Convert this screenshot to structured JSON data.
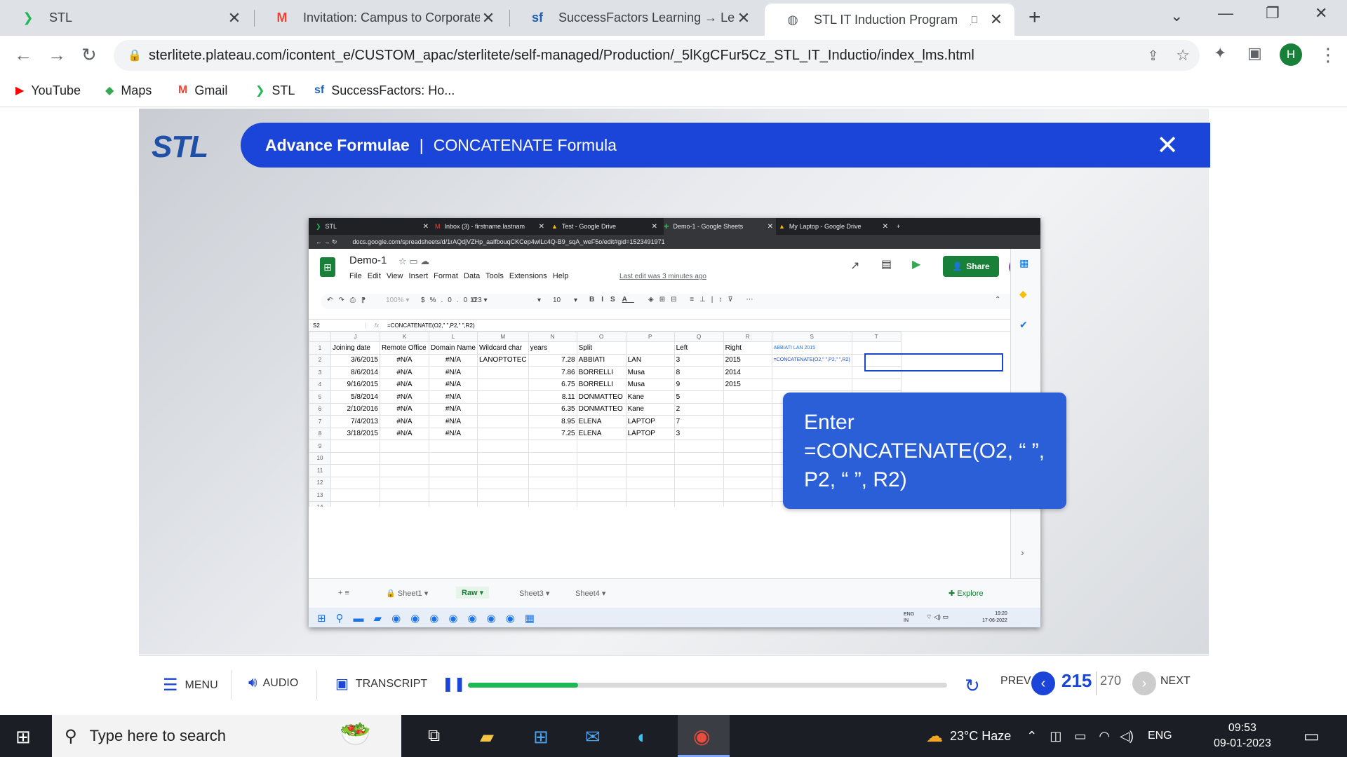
{
  "browser": {
    "tabs": [
      {
        "title": "STL",
        "icon": "stl-arrow-icon"
      },
      {
        "title": "Invitation: Campus to Corporate",
        "icon": "gmail-icon"
      },
      {
        "title": "SuccessFactors Learning → Learn",
        "icon": "successfactors-icon"
      },
      {
        "title": "STL IT Induction Program",
        "icon": "globe-icon"
      }
    ],
    "url": "sterlitete.plateau.com/icontent_e/CUSTOM_apac/sterlitete/self-managed/Production/_5lKgCFur5Cz_STL_IT_Inductio/index_lms.html",
    "bookmarks": [
      "YouTube",
      "Maps",
      "Gmail",
      "STL",
      "SuccessFactors: Ho..."
    ],
    "profile_initial": "H"
  },
  "course": {
    "logo": "STL",
    "title_bold": "Advance Formulae",
    "title_sep": "|",
    "title_rest": "CONCATENATE Formula",
    "callout": "Enter =CONCATENATE(O2, “ ”, P2, “ ”, R2)"
  },
  "embedded": {
    "tabs": [
      "STL",
      "Inbox (3) - firstname.lastnam",
      "Test - Google Drive",
      "Demo-1 - Google Sheets",
      "My Laptop - Google Drive"
    ],
    "url": "docs.google.com/spreadsheets/d/1rAQdjVZHp_aalfbouqCKCep4wlLc4Q-B9_sqA_weF5o/edit#gid=1523491971",
    "doc_title": "Demo-1",
    "menus": [
      "File",
      "Edit",
      "View",
      "Insert",
      "Format",
      "Data",
      "Tools",
      "Extensions",
      "Help"
    ],
    "last_edit": "Last edit was 3 minutes ago",
    "share": "Share",
    "avatar": "F",
    "cell_ref": "S2",
    "formula": "=CONCATENATE(O2,\" \",P2,\" \",R2)",
    "tooltip": "ABBIATI LAN 2015",
    "col_letters": [
      "J",
      "K",
      "L",
      "M",
      "N",
      "O",
      "P",
      "Q",
      "R",
      "S",
      "T"
    ],
    "headers": [
      "Joining date",
      "Remote Office",
      "Domain Name",
      "Wildcard char",
      "years",
      "Split",
      "",
      "Left",
      "Right",
      "",
      ""
    ],
    "rows": [
      [
        "3/6/2015",
        "#N/A",
        "#N/A",
        "LANOPTOTEC",
        "7.28",
        "ABBIATI",
        "LAN",
        "3",
        "2015",
        "=CONCATENATE(O2,\" \",P2,\" \",R2)",
        ""
      ],
      [
        "8/6/2014",
        "#N/A",
        "#N/A",
        "",
        "7.86",
        "BORRELLI",
        "Musa",
        "8",
        "2014",
        "",
        ""
      ],
      [
        "9/16/2015",
        "#N/A",
        "#N/A",
        "",
        "6.75",
        "BORRELLI",
        "Musa",
        "9",
        "2015",
        "",
        ""
      ],
      [
        "5/8/2014",
        "#N/A",
        "#N/A",
        "",
        "8.11",
        "DONMATTEO",
        "Kane",
        "5",
        "",
        "",
        ""
      ],
      [
        "2/10/2016",
        "#N/A",
        "#N/A",
        "",
        "6.35",
        "DONMATTEO",
        "Kane",
        "2",
        "",
        "",
        ""
      ],
      [
        "7/4/2013",
        "#N/A",
        "#N/A",
        "",
        "8.95",
        "ELENA",
        "LAPTOP",
        "7",
        "",
        "",
        ""
      ],
      [
        "3/18/2015",
        "#N/A",
        "#N/A",
        "",
        "7.25",
        "ELENA",
        "LAPTOP",
        "3",
        "",
        "",
        ""
      ]
    ],
    "sheet_tabs": [
      "Sheet1",
      "Raw",
      "Sheet3",
      "Sheet4"
    ],
    "explore": "Explore",
    "task_time": "19:20",
    "task_date": "17-06-2022",
    "task_lang": "ENG IN"
  },
  "player": {
    "menu": "MENU",
    "audio": "AUDIO",
    "transcript": "TRANSCRIPT",
    "prev": "PREV",
    "next": "NEXT",
    "current_page": "215",
    "total_pages": "270",
    "progress_fraction": 0.23
  },
  "taskbar": {
    "search_placeholder": "Type here to search",
    "weather": "23°C  Haze",
    "lang": "ENG",
    "time": "09:53",
    "date": "09-01-2023"
  }
}
